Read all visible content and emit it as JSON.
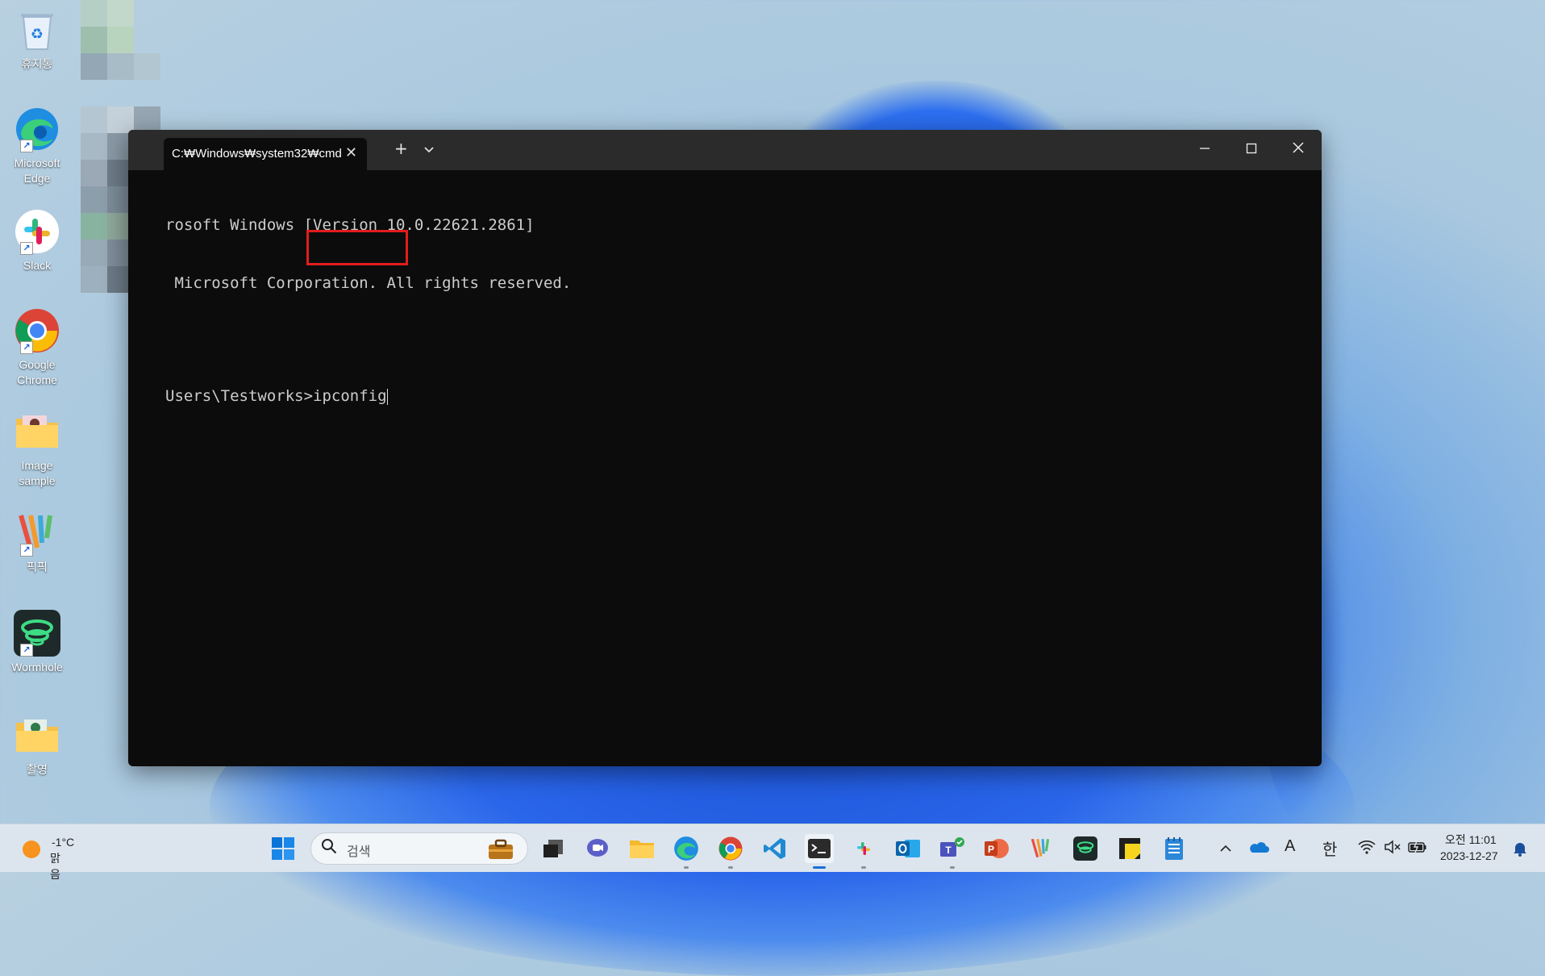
{
  "desktop": {
    "icons": [
      {
        "label": "휴지통",
        "icon": "recycle-bin-icon"
      },
      {
        "label": "Microsoft Edge",
        "icon": "edge-icon"
      },
      {
        "label": "Slack",
        "icon": "slack-icon"
      },
      {
        "label": "Google Chrome",
        "icon": "chrome-icon"
      },
      {
        "label": "Image sample",
        "icon": "folder-icon"
      },
      {
        "label": "픽픽",
        "icon": "picpick-icon"
      },
      {
        "label": "Wormhole",
        "icon": "wormhole-icon"
      },
      {
        "label": "촬영",
        "icon": "folder-icon"
      }
    ]
  },
  "terminal": {
    "tab_title": "C:₩Windows₩system32₩cmd",
    "new_tab": "+",
    "dropdown": "⌄",
    "minimize": "—",
    "maximize": "☐",
    "close": "✕",
    "lines": [
      "rosoft Windows [Version 10.0.22621.2861]",
      " Microsoft Corporation. All rights reserved.",
      "",
      "Users\\Testworks>ipconfig"
    ]
  },
  "taskbar": {
    "weather_temp": "-1°C",
    "weather_desc": "맑음",
    "search_placeholder": "검색",
    "ime_mode": "A",
    "ime_lang": "한",
    "time": "오전 11:01",
    "date": "2023-12-27"
  },
  "colors": {
    "highlight": "#e21c1c",
    "terminal_bg": "#0c0c0c",
    "taskbar_bg": "#dce5ee"
  }
}
